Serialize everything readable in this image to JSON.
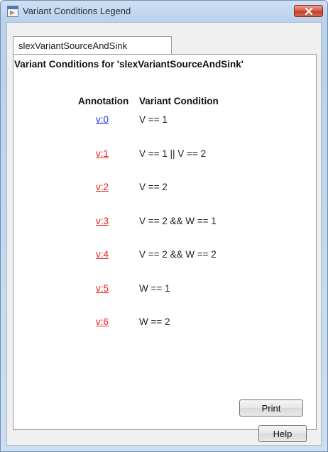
{
  "window": {
    "title": "Variant Conditions Legend"
  },
  "tab": {
    "label": "slexVariantSourceAndSink"
  },
  "panel": {
    "heading": "Variant Conditions for 'slexVariantSourceAndSink'",
    "column_annotation": "Annotation",
    "column_condition": "Variant Condition",
    "rows": [
      {
        "annotation": "v:0",
        "condition": "V == 1",
        "link_color": "#1a2ee8"
      },
      {
        "annotation": "v:1",
        "condition": "V == 1 || V == 2",
        "link_color": "#e8201a"
      },
      {
        "annotation": "v:2",
        "condition": "V == 2",
        "link_color": "#e8201a"
      },
      {
        "annotation": "v:3",
        "condition": "V == 2 && W == 1",
        "link_color": "#e8201a"
      },
      {
        "annotation": "v:4",
        "condition": "V == 2 && W == 2",
        "link_color": "#e8201a"
      },
      {
        "annotation": "v:5",
        "condition": "W == 1",
        "link_color": "#e8201a"
      },
      {
        "annotation": "v:6",
        "condition": "W == 2",
        "link_color": "#e8201a"
      }
    ],
    "print_label": "Print"
  },
  "footer": {
    "help_label": "Help"
  },
  "icons": {
    "app": "simulink-window-icon",
    "close": "close-icon"
  }
}
